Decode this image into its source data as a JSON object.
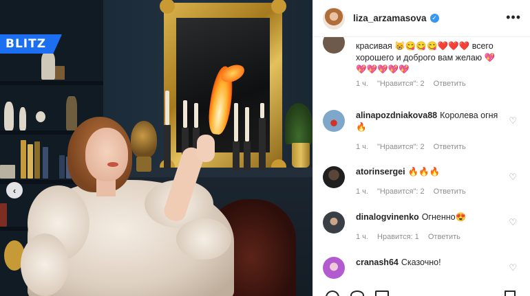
{
  "watermark": {
    "brand": "BLITZ",
    "color": "#1c6ff0"
  },
  "photo_nav": {
    "prev_icon": "chevron-left-icon",
    "prev_glyph": "‹"
  },
  "post_header": {
    "username": "liza_arzamasova",
    "verified": true,
    "verified_glyph": "✓",
    "more_glyph": "•••"
  },
  "comments": [
    {
      "username": "",
      "text": "красивая 😸😋😋😋❤️❤️❤️ всего хорошего и доброго вам желаю 💖💖💖💖💖💖",
      "time": "1 ч.",
      "likes": "\"Нравится\": 2",
      "reply": "Ответить",
      "liked_icon": ""
    },
    {
      "username": "alinapozdniakova88",
      "text": "Королева огня🔥",
      "time": "1 ч.",
      "likes": "\"Нравится\": 2",
      "reply": "Ответить",
      "liked_icon": "heart-outline-icon"
    },
    {
      "username": "atorinsergei",
      "text": "🔥🔥🔥",
      "time": "1 ч.",
      "likes": "\"Нравится\": 2",
      "reply": "Ответить",
      "liked_icon": "heart-outline-icon"
    },
    {
      "username": "dinalogvinenko",
      "text": "Огненно😍",
      "time": "1 ч.",
      "likes": "Нравится: 1",
      "reply": "Ответить",
      "liked_icon": "heart-outline-icon"
    },
    {
      "username": "cranash64",
      "text": "Сказочно!",
      "time": "",
      "likes": "",
      "reply": "",
      "liked_icon": "heart-outline-icon"
    }
  ],
  "heart_glyph": "♡"
}
